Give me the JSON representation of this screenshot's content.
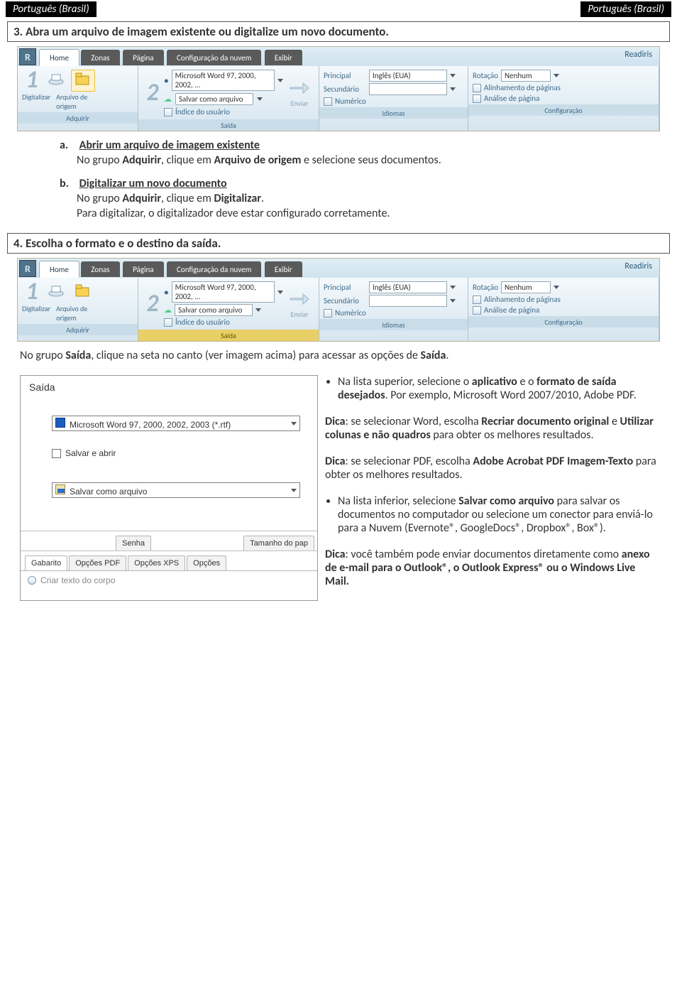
{
  "banner": {
    "left": "Português (Brasil)",
    "right": "Português (Brasil)"
  },
  "step3": {
    "heading": "3. Abra um arquivo de imagem existente ou digitalize um novo documento."
  },
  "ribbon": {
    "app_title": "Readiris",
    "tabs": {
      "home": "Home",
      "zonas": "Zonas",
      "pagina": "Página",
      "config": "Configuração da nuvem",
      "exibir": "Exibir"
    },
    "acquire": {
      "digitalize": "Digitalizar",
      "arquivo_de_origem": "Arquivo de\norigem",
      "group_label": "Adquirir"
    },
    "output": {
      "word": "Microsoft Word 97, 2000, 2002, ...",
      "salvar_como": "Salvar como arquivo",
      "indice": "Índice do usuário",
      "enviar": "Enviar",
      "group_label": "Saída"
    },
    "langs": {
      "principal": "Principal",
      "principal_val": "Inglês (EUA)",
      "secundario": "Secundário",
      "numerico": "Numérico",
      "group_label": "Idiomas"
    },
    "config": {
      "rotacao": "Rotação",
      "rotacao_val": "Nenhum",
      "alinhamento": "Alinhamento de páginas",
      "analise": "Análise de página",
      "group_label": "Configuração"
    }
  },
  "step3body": {
    "a_title": "Abrir um arquivo de imagem existente",
    "a_text1": "No grupo ",
    "a_bold1": "Adquirir",
    "a_text2": ", clique em ",
    "a_bold2": "Arquivo de origem",
    "a_text3": " e selecione seus documentos.",
    "b_title": "Digitalizar um novo documento",
    "b_line1a": "No grupo ",
    "b_line1b": "Adquirir",
    "b_line1c": ", clique em ",
    "b_line1d": "Digitalizar",
    "b_line1e": ".",
    "b_line2": "Para digitalizar, o digitalizador deve estar configurado corretamente."
  },
  "step4": {
    "heading": "4. Escolha o formato e o destino da saída."
  },
  "para1a": "No grupo ",
  "para1b": "Saída",
  "para1c": ", clique na seta no canto (ver imagem acima) para acessar as opções de ",
  "para1d": "Saída",
  "para1e": ".",
  "dialog": {
    "title": "Saída",
    "combo1": "Microsoft Word 97, 2000, 2002, 2003 (*.rtf)",
    "check1": "Salvar e abrir",
    "combo2": "Salvar como arquivo",
    "tabs_row1": {
      "senha": "Senha",
      "tamanho": "Tamanho do pap"
    },
    "tabs_row2": {
      "gabarito": "Gabarito",
      "opcoes_pdf": "Opções PDF",
      "opcoes_xps": "Opções XPS",
      "opcoes": "Opções"
    },
    "below": "Criar texto do corpo"
  },
  "right": {
    "b1a": "Na lista superior, selecione o ",
    "b1b": "aplicativo",
    "b1c": " e o ",
    "b1d": "formato de saída desejados",
    "b1e": ". Por exemplo, Microsoft Word 2007/2010, Adobe PDF.",
    "tip1a": "Dica",
    "tip1b": ": se selecionar Word, escolha ",
    "tip1c": "Recriar documento original",
    "tip1d": "  e ",
    "tip1e": "Utilizar colunas e não quadros",
    "tip1f": " para obter os melhores resultados.",
    "tip2a": "Dica",
    "tip2b": ": se selecionar PDF, escolha ",
    "tip2c": "Adobe Acrobat PDF Imagem-Texto",
    "tip2d": " para obter os melhores resultados.",
    "b2a": "Na lista inferior, selecione ",
    "b2b": "Salvar como arquivo",
    "b2c": " para salvar os documentos no computador ou selecione um conector para enviá-lo para a Nuvem (Evernote®, GoogleDocs®, Dropbox®, Box®).",
    "tip3a": "Dica",
    "tip3b": ": você também pode enviar documentos diretamente como ",
    "tip3c": "anexo de e-mail para o Outlook®, o Outlook Express® ou o Windows Live Mail."
  }
}
